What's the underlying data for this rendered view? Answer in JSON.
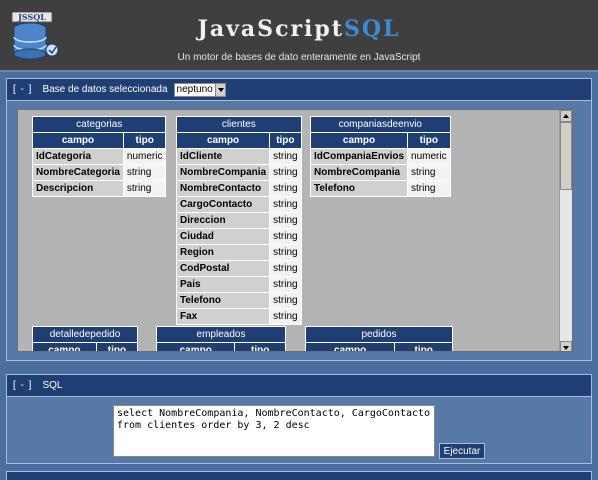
{
  "header": {
    "logo_text": "JSSQL",
    "title_part1": "JavaScript",
    "title_part2": "SQL",
    "subtitle": "Un motor de bases de dato enteramente en JavaScript"
  },
  "db_panel": {
    "toggle": "[ - ]",
    "label": "Base de datos seleccionada",
    "selected_db": "neptuno"
  },
  "schema": {
    "col_campo": "campo",
    "col_tipo": "tipo",
    "tables": [
      {
        "name": "categorias",
        "fields": [
          {
            "campo": "IdCategoria",
            "tipo": "numeric"
          },
          {
            "campo": "NombreCategoria",
            "tipo": "string"
          },
          {
            "campo": "Descripcion",
            "tipo": "string"
          }
        ]
      },
      {
        "name": "clientes",
        "fields": [
          {
            "campo": "IdCliente",
            "tipo": "string"
          },
          {
            "campo": "NombreCompania",
            "tipo": "string"
          },
          {
            "campo": "NombreContacto",
            "tipo": "string"
          },
          {
            "campo": "CargoContacto",
            "tipo": "string"
          },
          {
            "campo": "Direccion",
            "tipo": "string"
          },
          {
            "campo": "Ciudad",
            "tipo": "string"
          },
          {
            "campo": "Region",
            "tipo": "string"
          },
          {
            "campo": "CodPostal",
            "tipo": "string"
          },
          {
            "campo": "Pais",
            "tipo": "string"
          },
          {
            "campo": "Telefono",
            "tipo": "string"
          },
          {
            "campo": "Fax",
            "tipo": "string"
          }
        ]
      },
      {
        "name": "companiasdeenvio",
        "fields": [
          {
            "campo": "IdCompaniaEnvios",
            "tipo": "numeric"
          },
          {
            "campo": "NombreCompania",
            "tipo": "string"
          },
          {
            "campo": "Telefono",
            "tipo": "string"
          }
        ]
      },
      {
        "name": "detalledepedido",
        "fields": []
      },
      {
        "name": "empleados",
        "fields": []
      },
      {
        "name": "pedidos",
        "fields": []
      }
    ]
  },
  "sql_panel": {
    "toggle": "[ - ]",
    "label": "SQL",
    "query": "select NombreCompania, NombreContacto, CargoContacto\nfrom clientes order by 3, 2 desc",
    "execute_label": "Ejecutar"
  },
  "colors": {
    "background": "#4a6e9e",
    "header_bg": "#3f3f3f",
    "bar_bg": "#1f3f74",
    "title_accent": "#3d8ad3"
  }
}
